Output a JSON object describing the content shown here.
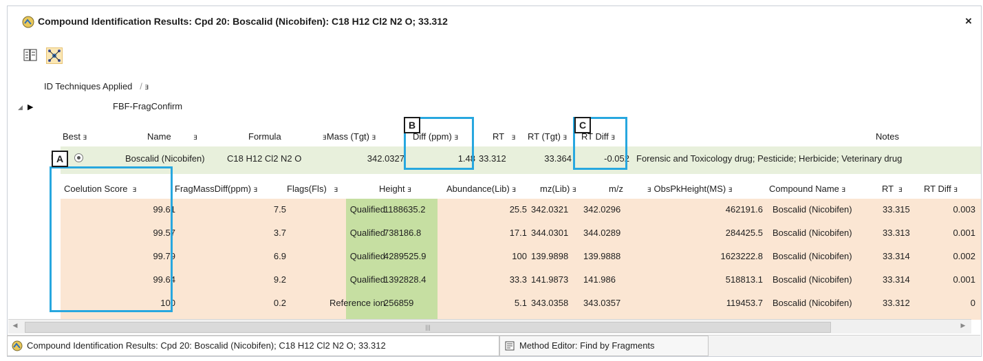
{
  "window": {
    "title": "Compound Identification Results: Cpd 20: Boscalid (Nicobifen): C18 H12 Cl2 N2 O; 33.312",
    "close_glyph": "×",
    "icons": [
      "compound-results-icon",
      "list-icon",
      "network-icon"
    ]
  },
  "id_techniques": {
    "label": "ID Techniques Applied",
    "sort_glyph": "/",
    "pin_glyph": "ⱻ",
    "technique": "FBF-FragConfirm"
  },
  "main_table": {
    "headers": [
      "Best",
      "Name",
      "Formula",
      "Mass (Tgt)",
      "Diff (ppm)",
      "RT",
      "RT (Tgt)",
      "RT Diff",
      "Notes"
    ],
    "row": {
      "name": "Boscalid (Nicobifen)",
      "formula": "C18 H12 Cl2 N2 O",
      "mass_tgt": "342.0327",
      "diff_ppm": "1.48",
      "rt": "33.312",
      "rt_tgt": "33.364",
      "rt_diff": "-0.052",
      "notes": "Forensic and Toxicology drug; Pesticide; Herbicide; Veterinary drug"
    }
  },
  "fragment_table": {
    "headers": [
      "Coelution Score",
      "FragMassDiff(ppm)",
      "Flags(Fls)",
      "Height",
      "Abundance(Lib)",
      "mz(Lib)",
      "m/z",
      "ObsPkHeight(MS)",
      "Compound Name",
      "RT",
      "RT Diff"
    ],
    "rows": [
      [
        "99.61",
        "7.5",
        "Qualified",
        "1188635.2",
        "25.5",
        "342.0321",
        "342.0296",
        "462191.6",
        "Boscalid (Nicobifen)",
        "33.315",
        "0.003"
      ],
      [
        "99.57",
        "3.7",
        "Qualified",
        "738186.8",
        "17.1",
        "344.0301",
        "344.0289",
        "284425.5",
        "Boscalid (Nicobifen)",
        "33.313",
        "0.001"
      ],
      [
        "99.79",
        "6.9",
        "Qualified",
        "4289525.9",
        "100",
        "139.9898",
        "139.9888",
        "1623222.8",
        "Boscalid (Nicobifen)",
        "33.314",
        "0.002"
      ],
      [
        "99.64",
        "9.2",
        "Qualified",
        "1392828.4",
        "33.3",
        "141.9873",
        "141.986",
        "518813.1",
        "Boscalid (Nicobifen)",
        "33.314",
        "0.001"
      ],
      [
        "100",
        "0.2",
        "Reference ion",
        "256859",
        "5.1",
        "343.0358",
        "343.0357",
        "119453.7",
        "Boscalid (Nicobifen)",
        "33.312",
        "0"
      ]
    ]
  },
  "scrollbar": {
    "left_glyph": "◀",
    "right_glyph": "▶",
    "grip_glyph": "|||"
  },
  "tabs": [
    {
      "label": "Compound Identification Results: Cpd 20: Boscalid (Nicobifen); C18 H12 Cl2 N2 O; 33.312"
    },
    {
      "label": "Method Editor: Find by Fragments"
    }
  ],
  "callouts": [
    "A",
    "B",
    "C"
  ],
  "colors": {
    "callout_border": "#27a7df",
    "main_row_bg": "#e8f0dc",
    "frag_row_bg": "#fbe6d3",
    "flags_bg": "#c6dfa2"
  }
}
